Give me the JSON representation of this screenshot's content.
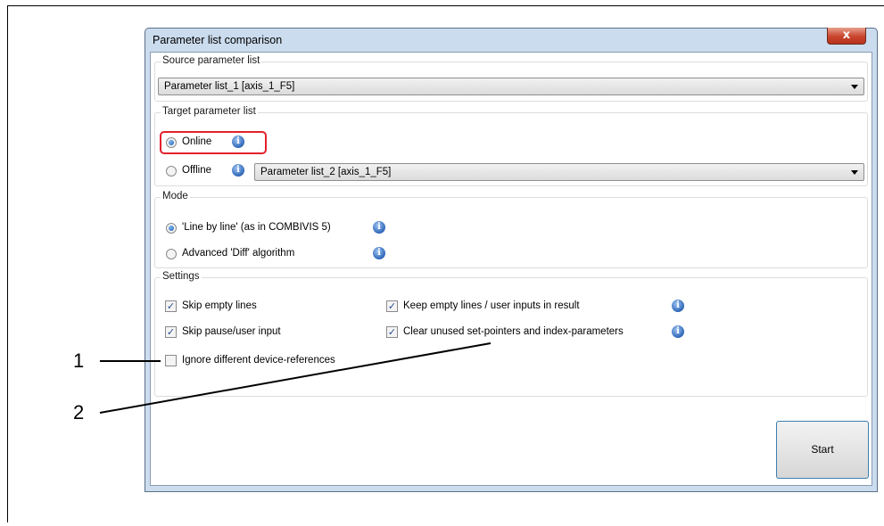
{
  "dialog": {
    "title": "Parameter list comparison",
    "close_symbol": "x"
  },
  "source": {
    "group_label": "Source parameter list",
    "selected": "Parameter list_1 [axis_1_F5]"
  },
  "target": {
    "group_label": "Target parameter list",
    "online_label": "Online",
    "offline_label": "Offline",
    "offline_selected": "Parameter list_2 [axis_1_F5]",
    "selected_option": "Online"
  },
  "mode": {
    "group_label": "Mode",
    "line_by_line_label": "'Line by line' (as in COMBIVIS 5)",
    "diff_label": "Advanced 'Diff' algorithm",
    "selected_option": "'Line by line' (as in COMBIVIS 5)"
  },
  "settings": {
    "group_label": "Settings",
    "skip_empty_lines": {
      "label": "Skip empty lines",
      "checked": true
    },
    "skip_pause": {
      "label": "Skip pause/user input",
      "checked": true
    },
    "ignore_refs": {
      "label": "Ignore different device-references",
      "checked": false
    },
    "keep_empty": {
      "label": "Keep empty lines / user inputs in result",
      "checked": true
    },
    "clear_unused": {
      "label": "Clear unused set-pointers and index-parameters",
      "checked": true
    }
  },
  "start_button": "Start",
  "callouts": {
    "one": "1",
    "two": "2"
  },
  "icons": {
    "info": "info-icon",
    "check_mark": "✓",
    "info_glyph": "i"
  },
  "colors": {
    "highlight": "#e2212b",
    "titlebar": "#cbdcee",
    "close": "#c8452c"
  }
}
